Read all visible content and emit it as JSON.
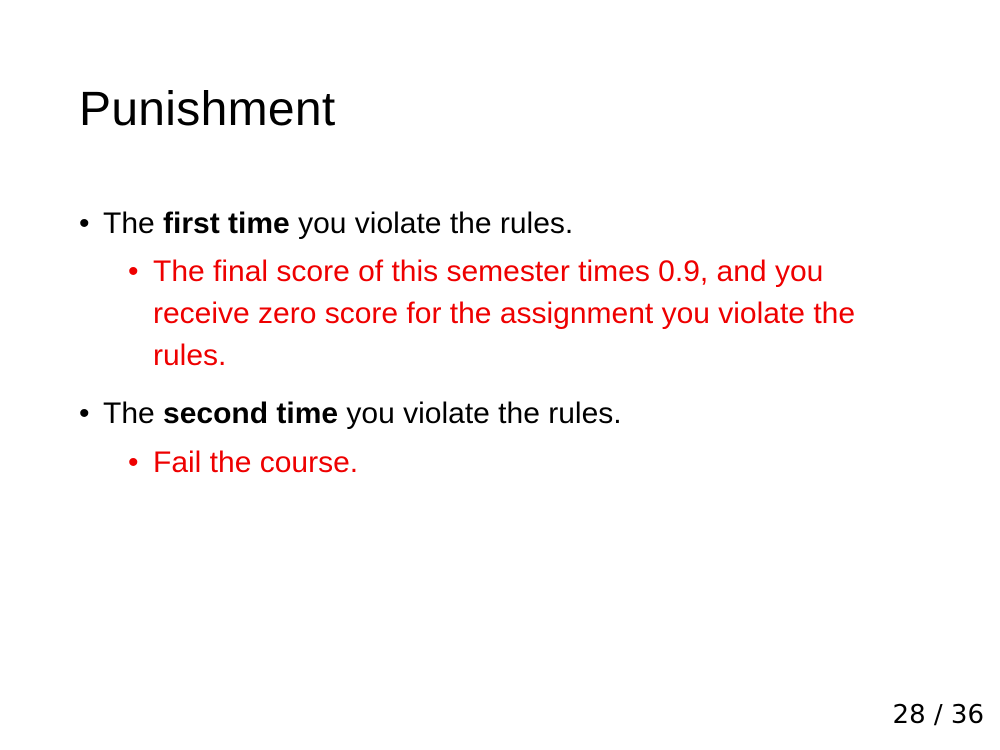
{
  "slide": {
    "title": "Punishment",
    "bullets": [
      {
        "prefix": "The ",
        "emphasis": "first time",
        "suffix": " you violate the rules.",
        "sub_bullet": "The final score of this semester times 0.9, and you receive zero score for the assignment you violate the rules."
      },
      {
        "prefix": "The ",
        "emphasis": "second time",
        "suffix": " you violate the rules.",
        "sub_bullet": "Fail the course."
      }
    ],
    "bullet_glyph": "•",
    "page_number": "28 / 36"
  },
  "colors": {
    "text": "#000000",
    "sub_bullet_text": "#ee0000",
    "background": "#ffffff"
  }
}
